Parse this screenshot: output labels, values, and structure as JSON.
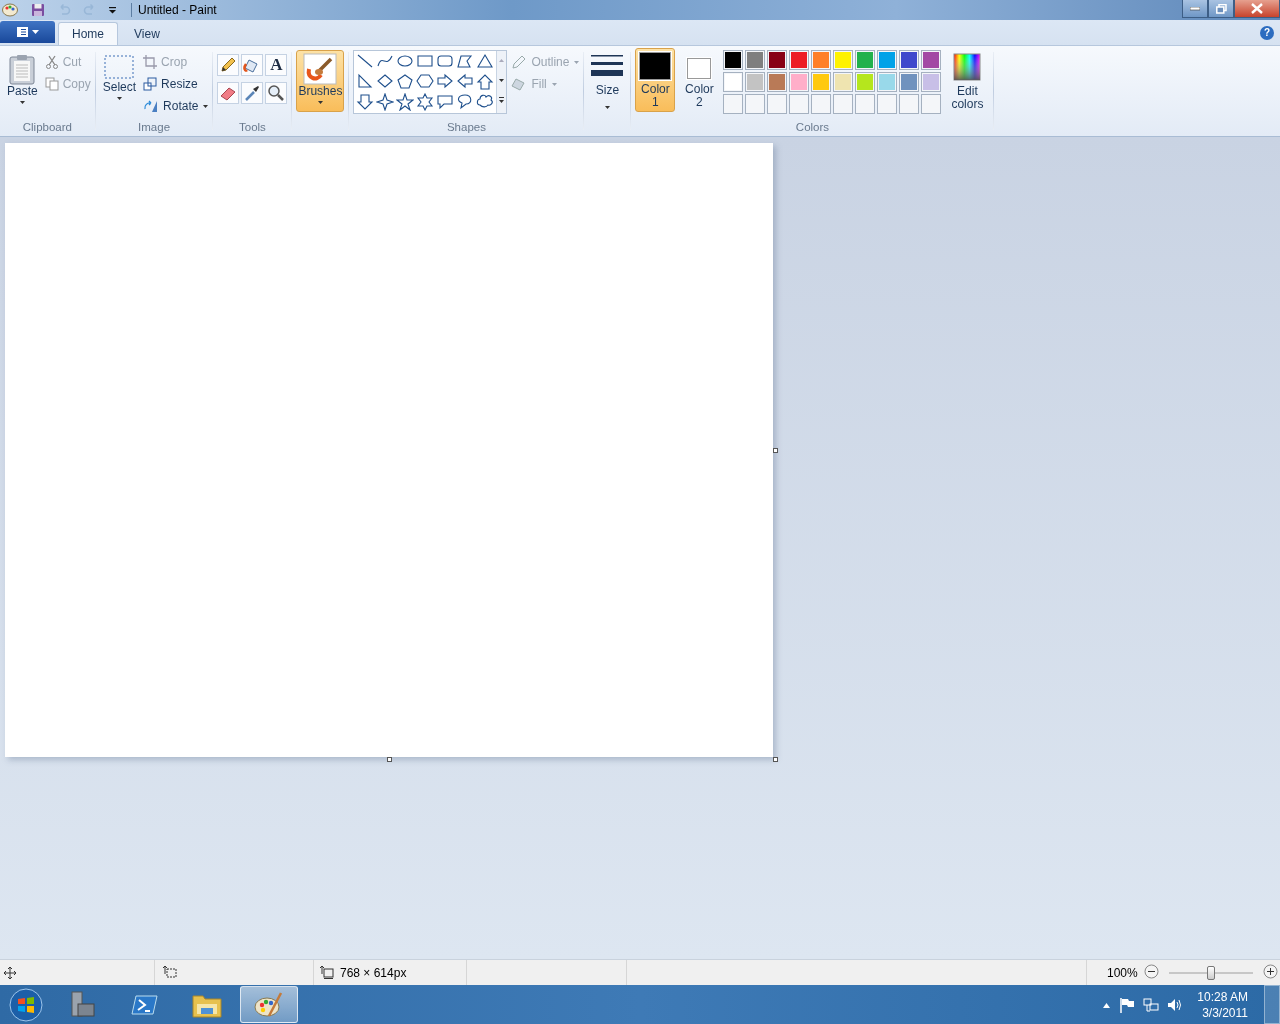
{
  "window": {
    "title": "Untitled - Paint",
    "quick_access": [
      {
        "kind": "save",
        "disabled": false
      },
      {
        "kind": "undo",
        "disabled": true
      },
      {
        "kind": "redo",
        "disabled": true
      }
    ]
  },
  "tabs": [
    {
      "label": "Home",
      "selected": true
    },
    {
      "label": "View",
      "selected": false
    }
  ],
  "help_button": "?",
  "clipboard": {
    "label": "Clipboard",
    "paste": "Paste",
    "items": [
      {
        "kind": "cut",
        "label": "Cut",
        "disabled": true
      },
      {
        "kind": "copy",
        "label": "Copy",
        "disabled": true
      }
    ]
  },
  "image": {
    "label": "Image",
    "select": "Select",
    "items": [
      {
        "kind": "crop",
        "label": "Crop",
        "disabled": true
      },
      {
        "kind": "resize",
        "label": "Resize",
        "disabled": false
      },
      {
        "kind": "rotate",
        "label": "Rotate",
        "disabled": false
      }
    ]
  },
  "tools": {
    "label": "Tools",
    "text_glyph": "A"
  },
  "brushes": {
    "label": "Brushes",
    "selected": true
  },
  "shapes": {
    "label": "Shapes",
    "outline": {
      "label": "Outline",
      "disabled": true
    },
    "fill": {
      "label": "Fill",
      "disabled": true
    }
  },
  "size": {
    "label": "Size"
  },
  "colors": {
    "label": "Colors",
    "color_1": {
      "label": "Color",
      "number": "1",
      "selected": true,
      "color": "#000000"
    },
    "color_2": {
      "label": "Color",
      "number": "2",
      "selected": false,
      "color": "#ffffff"
    },
    "palette": [
      {
        "color": "#000000"
      },
      {
        "color": "#7f7f7f"
      },
      {
        "color": "#880015"
      },
      {
        "color": "#ed1c24"
      },
      {
        "color": "#ff7f27"
      },
      {
        "color": "#fff200"
      },
      {
        "color": "#22b14c"
      },
      {
        "color": "#00a2e8"
      },
      {
        "color": "#3f48cc"
      },
      {
        "color": "#a349a4"
      },
      {
        "color": "#ffffff"
      },
      {
        "color": "#c3c3c3"
      },
      {
        "color": "#b97a57"
      },
      {
        "color": "#ffaec9"
      },
      {
        "color": "#ffc90e"
      },
      {
        "color": "#efe4b0"
      },
      {
        "color": "#b5e61d"
      },
      {
        "color": "#99d9ea"
      },
      {
        "color": "#7092be"
      },
      {
        "color": "#c8bfe7"
      }
    ],
    "edit_colors": "Edit colors"
  },
  "status_bar": {
    "image_size": "768 × 614px",
    "zoom": "100%",
    "zoom_level": {
      "level": 0.5
    }
  },
  "taskbar": {
    "apps": [
      {
        "kind": "server",
        "selected": false
      },
      {
        "kind": "powershell",
        "selected": false
      },
      {
        "kind": "explorer",
        "selected": false
      },
      {
        "kind": "paint",
        "selected": true
      }
    ],
    "time": "10:28 AM",
    "date": "3/3/2011"
  }
}
